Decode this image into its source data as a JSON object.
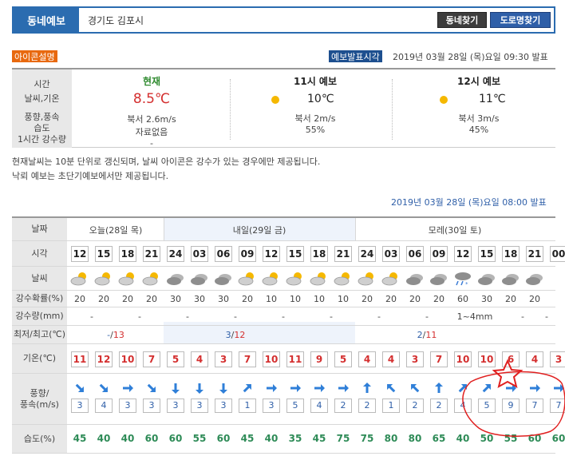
{
  "topbar": {
    "tab": "동네예보",
    "location": "경기도 김포시",
    "btn_dong": "동네찾기",
    "btn_road": "도로명찾기"
  },
  "icon_explain": "아이콘설명",
  "release": {
    "label": "예보발표시각",
    "time": "2019년 03월 28일 (목)요일 09:30 발표"
  },
  "current": {
    "labels": [
      "시간",
      "날씨,기온",
      "풍향,풍속",
      "습도",
      "1시간 강수량"
    ],
    "now": {
      "header": "현재",
      "temp": "8.5℃",
      "wind": "북서 2.6m/s",
      "humidity": "자료없음",
      "rain": "-"
    },
    "f11": {
      "header": "11시 예보",
      "temp": "10℃",
      "wind": "북서 2m/s",
      "humidity": "55%"
    },
    "f12": {
      "header": "12시 예보",
      "temp": "11℃",
      "wind": "북서 3m/s",
      "humidity": "45%"
    }
  },
  "notes": [
    "현재날씨는 10분 단위로 갱신되며, 날씨 아이콘은 강수가 있는 경우에만 제공됩니다.",
    "낙뢰 예보는 초단기예보에서만 제공됩니다."
  ],
  "release2": "2019년 03월 28일 (목)요일 08:00 발표",
  "forecast": {
    "row_labels": {
      "date": "날짜",
      "time": "시각",
      "weather": "날씨",
      "pop": "강수확률(%)",
      "rain": "강수량(mm)",
      "minmax": "최저/최고(℃)",
      "temp": "기온(℃)",
      "wind_a": "풍향/",
      "wind_b": "풍속(m/s)",
      "hum": "습도(%)"
    },
    "days": [
      "오늘(28일 목)",
      "내일(29일 금)",
      "모레(30일 토)"
    ],
    "times": [
      "12",
      "15",
      "18",
      "21",
      "24",
      "03",
      "06",
      "09",
      "12",
      "15",
      "18",
      "21",
      "24",
      "03",
      "06",
      "09",
      "12",
      "15",
      "18",
      "21",
      "00"
    ],
    "weather_icons": [
      "partly-cloudy-icon",
      "partly-cloudy-icon",
      "partly-cloudy-icon",
      "partly-cloudy-icon",
      "cloudy-icon",
      "cloudy-icon",
      "cloudy-icon",
      "partly-cloudy-icon",
      "partly-cloudy-icon",
      "partly-cloudy-icon",
      "partly-cloudy-icon",
      "partly-cloudy-icon",
      "partly-cloudy-icon",
      "partly-cloudy-icon",
      "cloudy-icon",
      "cloudy-icon",
      "rain-snow-icon",
      "cloudy-icon",
      "cloudy-icon",
      "cloudy-icon"
    ],
    "pop": [
      "20",
      "20",
      "20",
      "20",
      "30",
      "30",
      "30",
      "20",
      "10",
      "10",
      "10",
      "10",
      "20",
      "20",
      "20",
      "20",
      "60",
      "30",
      "20",
      "20"
    ],
    "rain": [
      "-",
      "-",
      "-",
      "-",
      "-",
      "-",
      "-",
      "-",
      "1~4mm",
      "-",
      "-"
    ],
    "minmax": [
      {
        "min": "-",
        "max": "13"
      },
      {
        "min": "3",
        "max": "12"
      },
      {
        "min": "2",
        "max": "11"
      }
    ],
    "temps": [
      "11",
      "12",
      "10",
      "7",
      "5",
      "4",
      "3",
      "7",
      "10",
      "11",
      "9",
      "5",
      "4",
      "4",
      "3",
      "7",
      "10",
      "10",
      "6",
      "4",
      "3"
    ],
    "wind_dirs": [
      "SE",
      "SE",
      "E",
      "SE",
      "S",
      "S",
      "S",
      "NE",
      "E",
      "E",
      "E",
      "E",
      "N",
      "NW",
      "NW",
      "N",
      "NE",
      "NE",
      "E",
      "E",
      "E"
    ],
    "wind_speeds": [
      "3",
      "4",
      "3",
      "3",
      "3",
      "3",
      "3",
      "1",
      "3",
      "5",
      "4",
      "2",
      "2",
      "1",
      "2",
      "2",
      "4",
      "5",
      "9",
      "7",
      "7"
    ],
    "humidity": [
      "45",
      "40",
      "40",
      "60",
      "60",
      "55",
      "60",
      "45",
      "40",
      "35",
      "45",
      "75",
      "75",
      "80",
      "80",
      "65",
      "40",
      "50",
      "55",
      "60",
      "60"
    ]
  },
  "colors": {
    "blue": "#2b6cb0",
    "orange": "#e8690f",
    "red": "#d42f2f",
    "green": "#2e8b57",
    "annotation": "#e02020"
  }
}
